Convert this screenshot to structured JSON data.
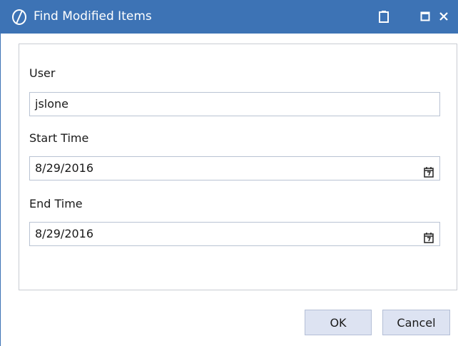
{
  "dialog": {
    "title": "Find Modified Items",
    "title_bar_color": "#3d73b5",
    "title_icons": [
      "logo-icon",
      "clipboard-icon",
      "maximize-icon",
      "close-icon"
    ]
  },
  "form": {
    "user": {
      "label": "User",
      "value": "jslone"
    },
    "start_time": {
      "label": "Start Time",
      "value": "8/29/2016",
      "icon": "calendar-icon"
    },
    "end_time": {
      "label": "End Time",
      "value": "8/29/2016",
      "icon": "calendar-icon"
    }
  },
  "buttons": {
    "ok_label": "OK",
    "cancel_label": "Cancel",
    "button_color": "#dde3f2"
  }
}
